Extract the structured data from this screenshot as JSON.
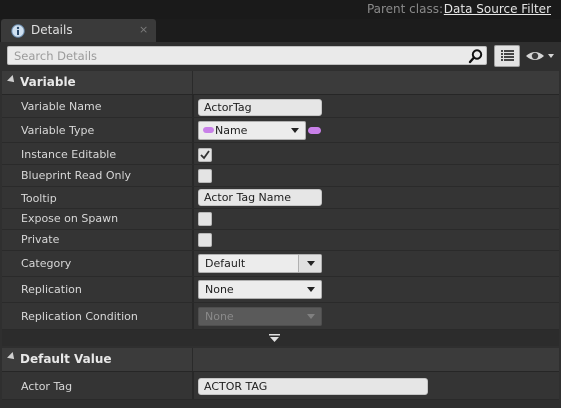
{
  "header": {
    "parent_class_label": "Parent class:",
    "parent_class_value": "Data Source Filter"
  },
  "tab": {
    "label": "Details",
    "close_glyph": "×",
    "icon": "details-info-icon"
  },
  "search": {
    "placeholder": "Search Details",
    "value": "",
    "icon": "search-icon"
  },
  "toolbar": {
    "list_view_icon": "list-view-icon",
    "view_options_icon": "eye-icon"
  },
  "sections": {
    "variable": {
      "title": "Variable",
      "rows": {
        "variable_name": {
          "label": "Variable Name",
          "value": "ActorTag"
        },
        "variable_type": {
          "label": "Variable Type",
          "value": "Name",
          "pin_color": "#c880e8"
        },
        "instance_editable": {
          "label": "Instance Editable",
          "checked": true
        },
        "blueprint_read_only": {
          "label": "Blueprint Read Only",
          "checked": false
        },
        "tooltip": {
          "label": "Tooltip",
          "value": "Actor Tag Name"
        },
        "expose_on_spawn": {
          "label": "Expose on Spawn",
          "checked": false
        },
        "private": {
          "label": "Private",
          "checked": false
        },
        "category": {
          "label": "Category",
          "value": "Default"
        },
        "replication": {
          "label": "Replication",
          "value": "None"
        },
        "replication_condition": {
          "label": "Replication Condition",
          "value": "None",
          "disabled": true
        }
      }
    },
    "default_value": {
      "title": "Default Value",
      "rows": {
        "actor_tag": {
          "label": "Actor Tag",
          "value": "ACTOR TAG"
        }
      }
    }
  },
  "colors": {
    "panel_bg": "#2f2f2f",
    "row_bg": "#343434",
    "header_bg": "#3b3b3b",
    "pin_purple": "#c880e8"
  }
}
